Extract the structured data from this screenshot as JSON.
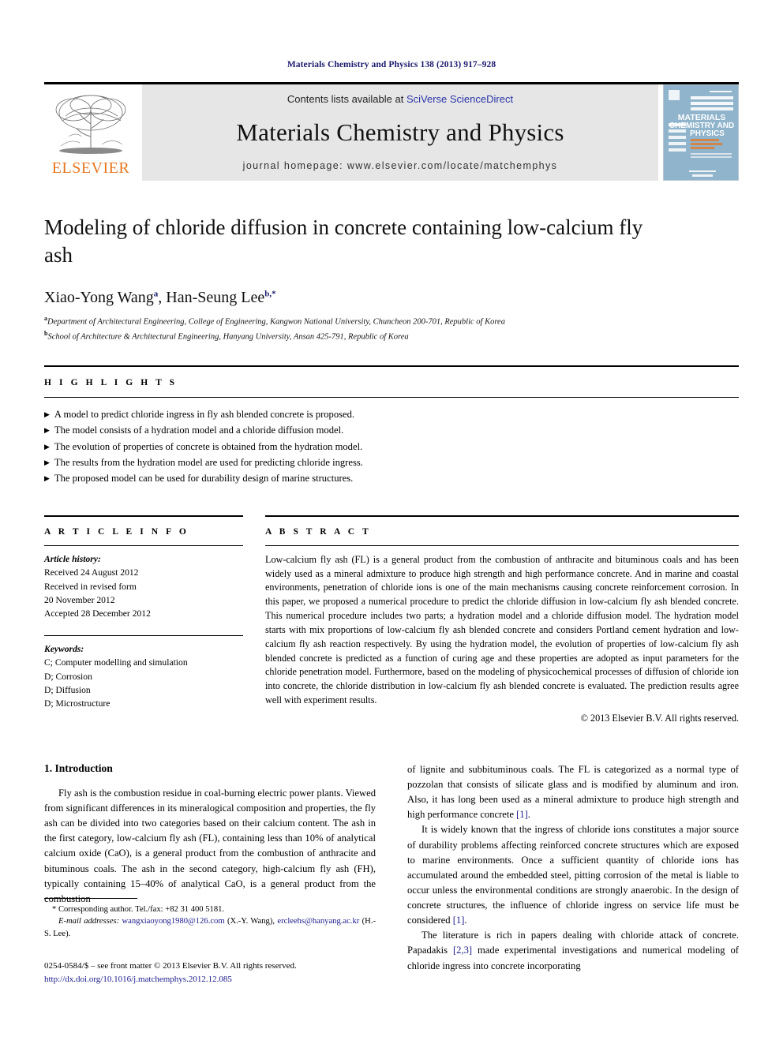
{
  "running_head": "Materials Chemistry and Physics 138 (2013) 917–928",
  "masthead": {
    "publisher_name": "ELSEVIER",
    "contents_prefix": "Contents lists available at ",
    "contents_link": "SciVerse ScienceDirect",
    "journal_name": "Materials Chemistry and Physics",
    "homepage": "journal homepage: www.elsevier.com/locate/matchemphys",
    "cover_line1": "MATERIALS",
    "cover_line2": "CHEMISTRY AND",
    "cover_line3": "PHYSICS"
  },
  "article": {
    "title": "Modeling of chloride diffusion in concrete containing low-calcium fly ash",
    "authors": [
      {
        "name": "Xiao-Yong Wang",
        "marker": "a"
      },
      {
        "name": "Han-Seung Lee",
        "marker": "b,*"
      }
    ],
    "affiliations": [
      {
        "marker": "a",
        "text": "Department of Architectural Engineering, College of Engineering, Kangwon National University, Chuncheon 200-701, Republic of Korea"
      },
      {
        "marker": "b",
        "text": "School of Architecture & Architectural Engineering, Hanyang University, Ansan 425-791, Republic of Korea"
      }
    ]
  },
  "highlights": {
    "heading": "H I G H L I G H T S",
    "items": [
      "A model to predict chloride ingress in fly ash blended concrete is proposed.",
      "The model consists of a hydration model and a chloride diffusion model.",
      "The evolution of properties of concrete is obtained from the hydration model.",
      "The results from the hydration model are used for predicting chloride ingress.",
      "The proposed model can be used for durability design of marine structures."
    ]
  },
  "article_info": {
    "heading": "A R T I C L E  I N F O",
    "history_label": "Article history:",
    "history": [
      "Received 24 August 2012",
      "Received in revised form",
      "20 November 2012",
      "Accepted 28 December 2012"
    ],
    "keywords_label": "Keywords:",
    "keywords": [
      "C; Computer modelling and simulation",
      "D; Corrosion",
      "D; Diffusion",
      "D; Microstructure"
    ]
  },
  "abstract": {
    "heading": "A B S T R A C T",
    "text": "Low-calcium fly ash (FL) is a general product from the combustion of anthracite and bituminous coals and has been widely used as a mineral admixture to produce high strength and high performance concrete. And in marine and coastal environments, penetration of chloride ions is one of the main mechanisms causing concrete reinforcement corrosion. In this paper, we proposed a numerical procedure to predict the chloride diffusion in low-calcium fly ash blended concrete. This numerical procedure includes two parts; a hydration model and a chloride diffusion model. The hydration model starts with mix proportions of low-calcium fly ash blended concrete and considers Portland cement hydration and low-calcium fly ash reaction respectively. By using the hydration model, the evolution of properties of low-calcium fly ash blended concrete is predicted as a function of curing age and these properties are adopted as input parameters for the chloride penetration model. Furthermore, based on the modeling of physicochemical processes of diffusion of chloride ion into concrete, the chloride distribution in low-calcium fly ash blended concrete is evaluated. The prediction results agree well with experiment results.",
    "copyright": "© 2013 Elsevier B.V. All rights reserved."
  },
  "introduction": {
    "heading": "1. Introduction",
    "left_paragraphs": [
      "Fly ash is the combustion residue in coal-burning electric power plants. Viewed from significant differences in its mineralogical composition and properties, the fly ash can be divided into two categories based on their calcium content. The ash in the first category, low-calcium fly ash (FL), containing less than 10% of analytical calcium oxide (CaO), is a general product from the combustion of anthracite and bituminous coals. The ash in the second category, high-calcium fly ash (FH), typically containing 15–40% of analytical CaO, is a general product from the combustion"
    ],
    "right_paragraphs": [
      {
        "indent": false,
        "parts": [
          {
            "t": "of lignite and subbituminous coals. The FL is categorized as a normal type of pozzolan that consists of silicate glass and is modified by aluminum and iron. Also, it has long been used as a mineral admixture to produce high strength and high performance concrete "
          },
          {
            "t": "[1]",
            "ref": true
          },
          {
            "t": "."
          }
        ]
      },
      {
        "indent": true,
        "parts": [
          {
            "t": "It is widely known that the ingress of chloride ions constitutes a major source of durability problems affecting reinforced concrete structures which are exposed to marine environments. Once a sufficient quantity of chloride ions has accumulated around the embedded steel, pitting corrosion of the metal is liable to occur unless the environmental conditions are strongly anaerobic. In the design of concrete structures, the influence of chloride ingress on service life must be considered "
          },
          {
            "t": "[1]",
            "ref": true
          },
          {
            "t": "."
          }
        ]
      },
      {
        "indent": true,
        "parts": [
          {
            "t": "The literature is rich in papers dealing with chloride attack of concrete. Papadakis "
          },
          {
            "t": "[2,3]",
            "ref": true
          },
          {
            "t": " made experimental investigations and numerical modeling of chloride ingress into concrete incorporating"
          }
        ]
      }
    ]
  },
  "footnotes": {
    "corresponding": "* Corresponding author. Tel./fax: +82 31 400 5181.",
    "email_label": "E-mail addresses:",
    "email1": "wangxiaoyong1980@126.com",
    "email1_owner": "(X.-Y. Wang)",
    "email2": "ercleehs@hanyang.ac.kr",
    "email2_owner": "(H.-S. Lee).",
    "front_matter": "0254-0584/$ – see front matter © 2013 Elsevier B.V. All rights reserved.",
    "doi": "http://dx.doi.org/10.1016/j.matchemphys.2012.12.085"
  },
  "colors": {
    "header_blue": "#1a1a6e",
    "link_blue": "#2a35a8",
    "elsevier_orange": "#e87722",
    "masthead_gray": "#e6e6e6",
    "cover_blue": "#8fb4cc"
  }
}
